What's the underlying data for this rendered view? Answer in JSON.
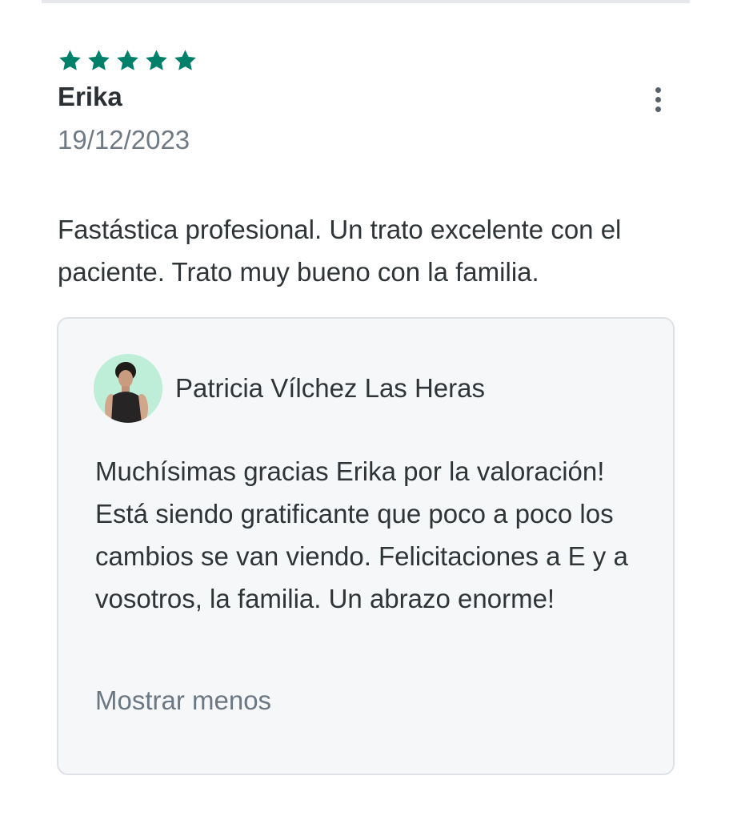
{
  "review": {
    "rating": 5,
    "rating_max": 5,
    "star_color": "#00806a",
    "author": "Erika",
    "date": "19/12/2023",
    "text": "Fastástica profesional. Un trato excelente con el paciente. Trato muy bueno con la familia."
  },
  "reply": {
    "professional_name": "Patricia Vílchez Las Heras",
    "text": "Muchísimas gracias Erika por la valoración! Está siendo gratificante que poco a poco los cambios se van viendo. Felicitaciones a E y a vosotros, la familia. Un abrazo enorme!",
    "toggle_label": "Mostrar menos"
  },
  "icons": {
    "star": "star-icon",
    "more": "more-vertical-icon",
    "avatar": "avatar"
  }
}
